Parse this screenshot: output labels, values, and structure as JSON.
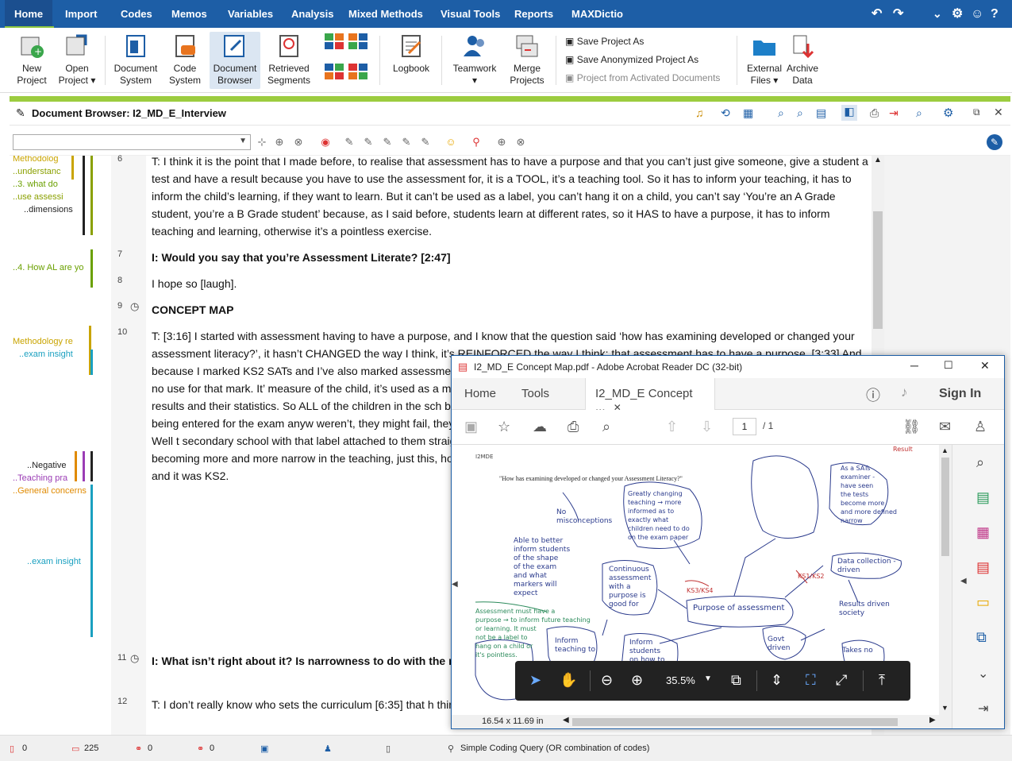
{
  "menu": {
    "items": [
      "Home",
      "Import",
      "Codes",
      "Memos",
      "Variables",
      "Analysis",
      "Mixed Methods",
      "Visual Tools",
      "Reports",
      "MAXDictio"
    ],
    "active": "Home"
  },
  "ribbon": {
    "new_project": "New\nProject",
    "open_project": "Open\nProject ▾",
    "document_system": "Document\nSystem",
    "code_system": "Code\nSystem",
    "document_browser": "Document\nBrowser",
    "retrieved_segments": "Retrieved\nSegments",
    "logbook": "Logbook",
    "teamwork": "Teamwork\n▾",
    "merge_projects": "Merge\nProjects",
    "save_project_as": "Save Project As",
    "save_anonymized": "Save Anonymized Project As",
    "project_from_activated": "Project from Activated Documents",
    "external_files": "External\nFiles ▾",
    "archive_data": "Archive\nData"
  },
  "doc_browser": {
    "title": "Document Browser: I2_MD_E_Interview"
  },
  "code_labels": [
    {
      "text": "Methodolog",
      "color": "#c9a400"
    },
    {
      "text": "..understanc",
      "color": "#8aa000"
    },
    {
      "text": "..3. what do",
      "color": "#6aa000"
    },
    {
      "text": "..use assessi",
      "color": "#8aa000"
    },
    {
      "text": "..dimensions",
      "color": "#222222"
    },
    {
      "text": "..4. How AL are yo",
      "color": "#6aa000"
    },
    {
      "text": "Methodology re",
      "color": "#c9a400"
    },
    {
      "text": "..exam insight",
      "color": "#1aa0c0"
    },
    {
      "text": "..Negative",
      "color": "#222222"
    },
    {
      "text": "..Teaching pra",
      "color": "#9b3db5"
    },
    {
      "text": "..General concerns",
      "color": "#e08a00"
    },
    {
      "text": "..exam insight",
      "color": "#1aa0c0"
    }
  ],
  "line_numbers": [
    "6",
    "7",
    "8",
    "9",
    "10",
    "11",
    "12"
  ],
  "paragraphs": [
    {
      "bold": false,
      "text": "T: I think it is the point that I made before, to realise that assessment has to have a purpose and that you can’t just give someone, give a student a test and have a result because you have to use the assessment for, it is a TOOL, it’s a teaching tool. So it has to inform your teaching, it has to inform the child’s learning, if they want to learn. But it can’t be used as a label, you can’t hang it on a child, you can’t say ‘You’re an A Grade student, you’re a B Grade student’ because, as I said before, students learn at different rates, so it HAS to have a purpose, it has to inform teaching and learning, otherwise it’s a pointless exercise."
    },
    {
      "bold": true,
      "text": "I: Would you say that you’re Assessment Literate? [2:47]"
    },
    {
      "bold": false,
      "text": "I hope so [laugh]."
    },
    {
      "bold": true,
      "text": "CONCEPT MAP"
    },
    {
      "bold": false,
      "text": "T: [3:16] I started with assessment having to have a purpose, and I know that the question said ‘how has examining developed or changed your assessment literacy?’, it hasn’t CHANGED the way I think, it’s REINFORCED the way I think: that assessment has to have a purpose. [3:33] And because I marked KS2 SATs and I’ve also marked assessment as a reasonably negative thing to do simply be end of KS2 and there’s absolutely no use for that mark. It’ measure of the child, it’s used as a measure of the school when I saw that the vast majority of schools don’t enter st results and their statistics. So ALL of the children in the sch breadth to it as there should be at that age because you w of these children are not being entered for the exam anyw weren’t, they might fail, they weren’t being given the cha Those who can take the exam and those who can’t. Well t secondary school with that label attached to them straigh point or it might be that they had other issues that hadn’t I saw the KS2 SATs becoming more and more narrow in the teaching, just this, how do these kids even want to go to s a label hung on them at Year 6 and off they trot and it was KS2."
    },
    {
      "bold": true,
      "text": "I: What isn’t right about it? Is narrowness to do with the n achieve?"
    },
    {
      "bold": false,
      "text": "T: I don’t really know who sets the curriculum [6:35] that h things, especially within English, that's really all I can com"
    }
  ],
  "status": {
    "s1": "0",
    "s2": "225",
    "s3": "0",
    "s4": "0",
    "query": "Simple Coding Query (OR combination of codes)"
  },
  "acrobat": {
    "title": "I2_MD_E Concept Map.pdf - Adobe Acrobat Reader DC (32-bit)",
    "tab_home": "Home",
    "tab_tools": "Tools",
    "tab_doc": "I2_MD_E Concept ...",
    "sign_in": "Sign In",
    "page_current": "1",
    "page_total": "/ 1",
    "zoom": "35.5%",
    "page_size": "16.54 x 11.69 in",
    "question": "\"How has examining developed or changed your Assessment Literacy?\"",
    "corner_label": "I2MDE",
    "center_node": "Purpose of assessment"
  }
}
